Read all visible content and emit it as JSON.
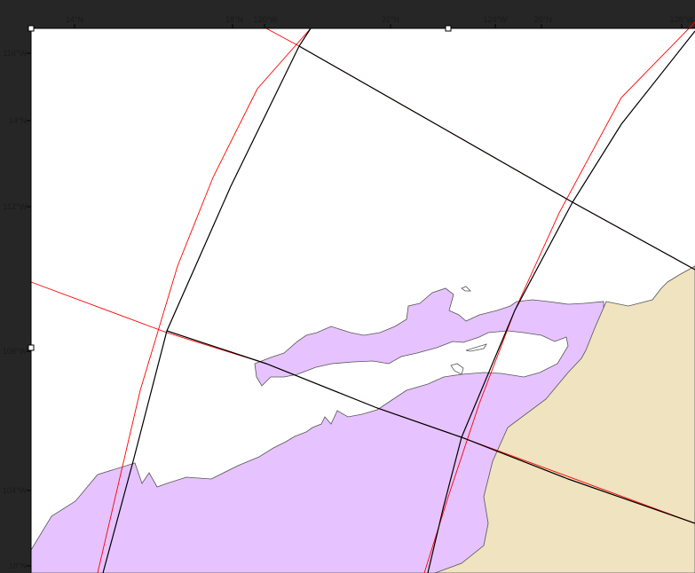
{
  "colors": {
    "outer_background": "#262626",
    "map_background": "#ffffff",
    "land_purple": "#e6c3ff",
    "land_tan": "#efe3c0",
    "coast_stroke": "#555555",
    "grid_black": "#000000",
    "grid_red": "#ff0000"
  },
  "map": {
    "top_axis_labels": [
      "14°N",
      "18°N",
      "120°W",
      "22°N",
      "124°W",
      "26°N",
      "128°W"
    ],
    "left_axis_labels": [
      "116°W",
      "14°N",
      "112°W",
      "108°W",
      "104°W",
      "18°N"
    ]
  }
}
